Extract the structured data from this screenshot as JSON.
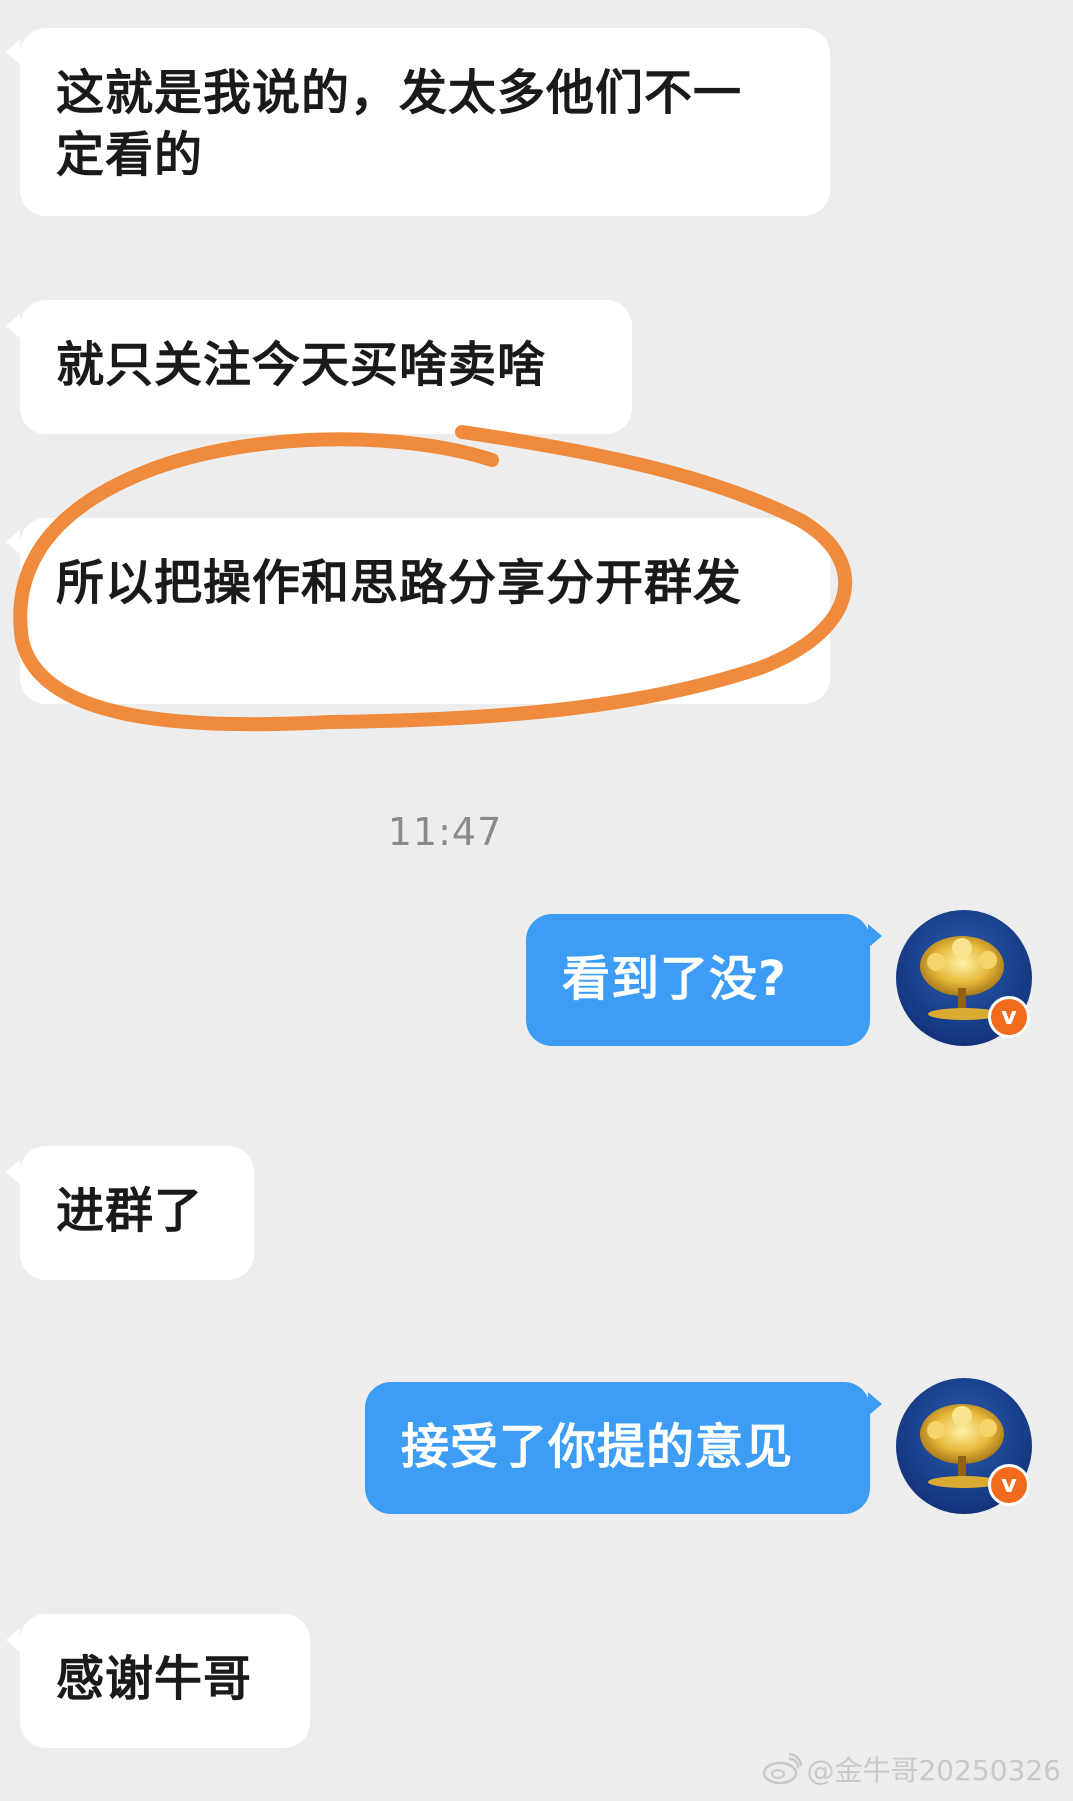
{
  "messages": [
    {
      "text": "这就是我说的，发太多他们不一定看的"
    },
    {
      "text": "就只关注今天买啥卖啥"
    },
    {
      "text": "所以把操作和思路分享分开群发"
    },
    {
      "text": "看到了没?"
    },
    {
      "text": "进群了"
    },
    {
      "text": "接受了你提的意见"
    },
    {
      "text": "感谢牛哥"
    }
  ],
  "timestamp": "11:47",
  "avatar": {
    "badge": "v",
    "icon": "money-tree-icon"
  },
  "watermark": {
    "text": "@金牛哥20250326",
    "icon": "weibo-icon"
  },
  "colors": {
    "background": "#ededed",
    "incoming_bubble": "#ffffff",
    "outgoing_bubble": "#3d9df5",
    "highlight_stroke": "#f08a3c",
    "badge": "#f26b1d"
  }
}
